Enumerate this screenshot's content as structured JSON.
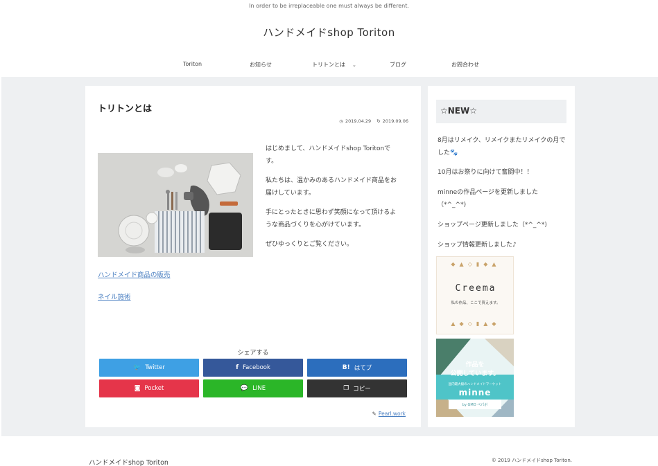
{
  "header": {
    "tagline": "In order to be irreplaceable one must always be different.",
    "site_title": "ハンドメイドshop Toriton"
  },
  "nav": {
    "items": [
      {
        "label": "Toriton"
      },
      {
        "label": "お知らせ"
      },
      {
        "label": "トリトンとは"
      },
      {
        "label": "ブログ"
      },
      {
        "label": "お問合わせ"
      }
    ]
  },
  "article": {
    "title": "トリトンとは",
    "posted_date": "2019.04.29",
    "updated_date": "2019.09.06",
    "paragraphs": [
      "はじめまして、ハンドメイドshop Toritonです。",
      "私たちは、温かみのあるハンドメイド商品をお届けしています。",
      "手にとったときに思わず笑顔になって頂けるような商品づくりを心がけています。",
      "ぜひゆっくりとご覧ください。"
    ],
    "links": [
      "ハンドメイド商品の販売",
      "ネイル施術"
    ],
    "share_title": "シェアする",
    "share_buttons": [
      {
        "label": "Twitter",
        "icon": "twitter-icon",
        "color": "#3ea0e4"
      },
      {
        "label": "Facebook",
        "icon": "facebook-icon",
        "color": "#35589a"
      },
      {
        "label": "はてブ",
        "icon": "hatena-icon",
        "color": "#2c6ebd"
      },
      {
        "label": "Pocket",
        "icon": "pocket-icon",
        "color": "#e5354a"
      },
      {
        "label": "LINE",
        "icon": "line-icon",
        "color": "#2bb628"
      },
      {
        "label": "コピー",
        "icon": "copy-icon",
        "color": "#333333"
      }
    ],
    "author": "Pearl.work"
  },
  "sidebar": {
    "heading": "☆NEW☆",
    "news": [
      "8月はリメイク、リメイクまたリメイクの月でした",
      "10月はお祭りに向けて奮闘中！！",
      "minneの作品ページを更新しました（*^_^*)",
      "ショップページ更新しました（*^_^*)",
      "ショップ情報更新しました♪"
    ],
    "creema": {
      "logo": "Creema",
      "sub": "私の作品、ここで買えます。"
    },
    "minne": {
      "line1": "作品を",
      "line2": "公開しています。",
      "small": "国内最大級のハンドメイドマーケット",
      "logo": "minne",
      "by": "by GMO ペパボ"
    }
  },
  "footer": {
    "site_name": "ハンドメイドshop Toriton",
    "copyright": "© 2019 ハンドメイドshop Toriton."
  }
}
